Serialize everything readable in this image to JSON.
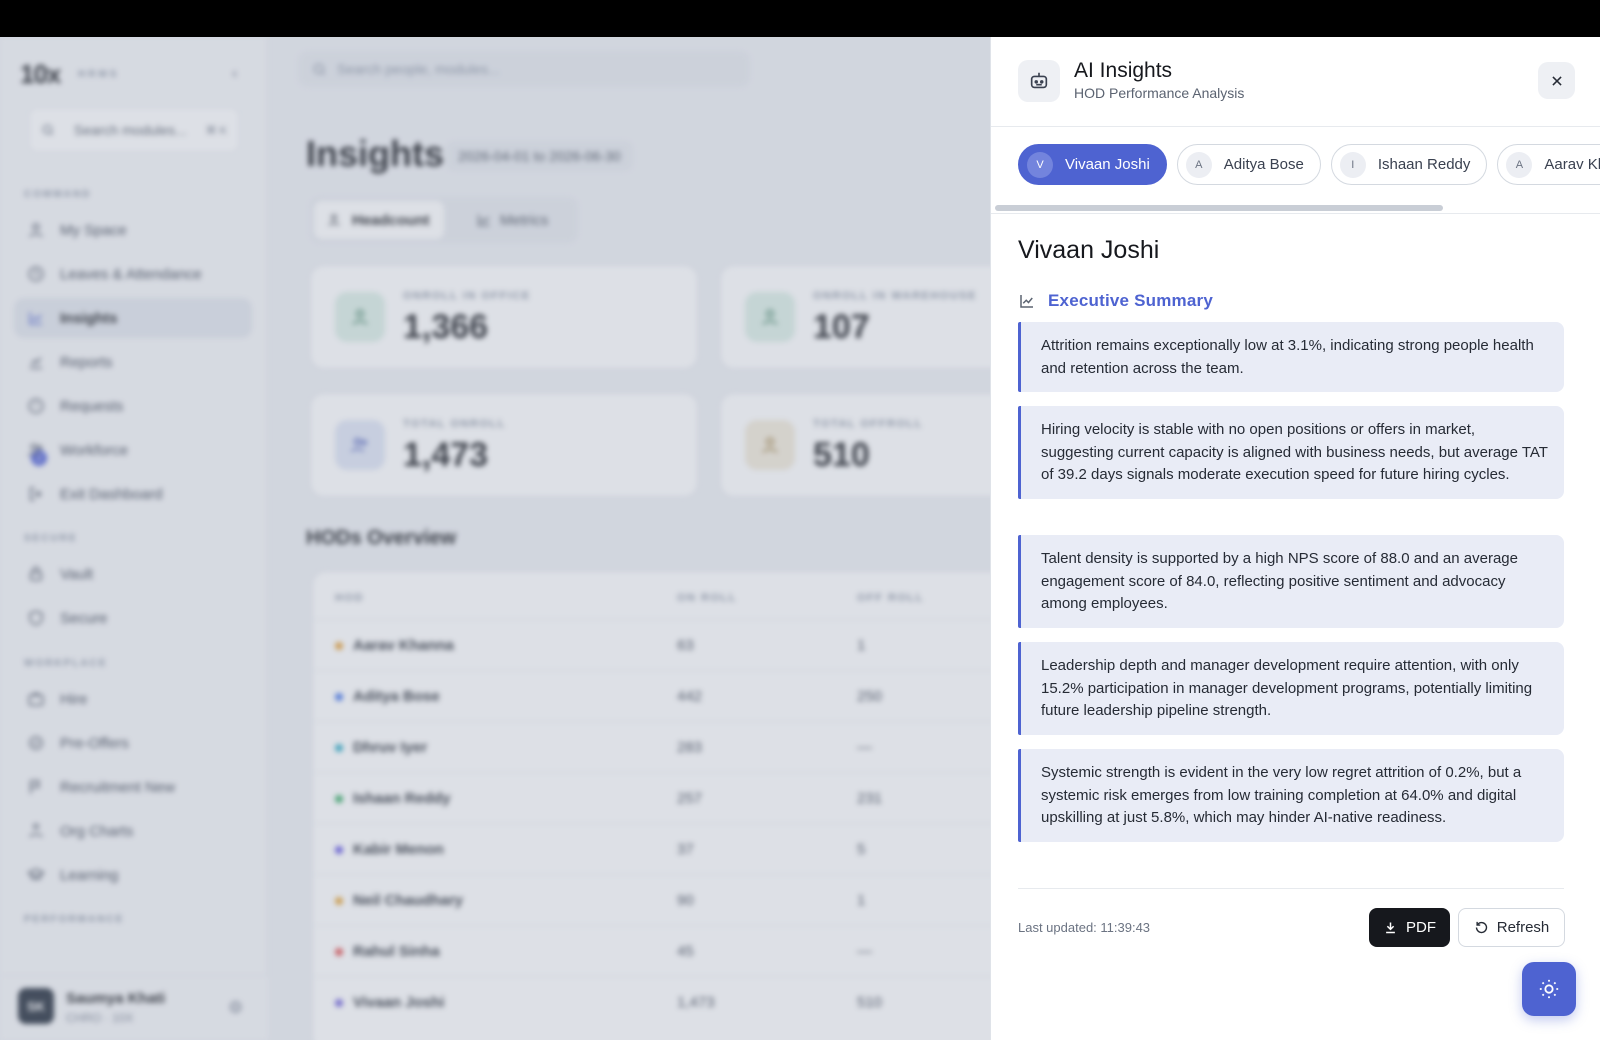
{
  "sidebar": {
    "logo": "10x",
    "logo_sub": "HRMS",
    "search_title": "Search modules...",
    "search_kbd": "⌘ K",
    "sections": {
      "command": "COMMAND",
      "secure": "SECURE",
      "workplace": "WORKPLACE",
      "performance": "PERFORMANCE"
    },
    "items": [
      {
        "label": "My Space",
        "icon": "user-icon"
      },
      {
        "label": "Leaves & Attendance",
        "icon": "clock-icon"
      },
      {
        "label": "Insights",
        "icon": "chart-icon"
      },
      {
        "label": "Reports",
        "icon": "reports-icon"
      },
      {
        "label": "Requests",
        "icon": "requests-icon"
      },
      {
        "label": "Workforce",
        "icon": "users-icon"
      },
      {
        "label": "Exit Dashboard",
        "icon": "exit-icon"
      },
      {
        "label": "Vault",
        "icon": "lock-icon"
      },
      {
        "label": "Secure",
        "icon": "shield-icon"
      },
      {
        "label": "Hire",
        "icon": "briefcase-icon"
      },
      {
        "label": "Pre-Offers",
        "icon": "badge-icon"
      },
      {
        "label": "Recruitment New",
        "icon": "flag-icon"
      },
      {
        "label": "Org Charts",
        "icon": "org-icon"
      },
      {
        "label": "Learning",
        "icon": "graduation-icon"
      }
    ],
    "requests_badge": "2",
    "user": {
      "initials": "SK",
      "name": "Saumya Khati",
      "role": "CHRO · 10X"
    }
  },
  "main": {
    "search_placeholder": "Search people, modules...",
    "title": "Insights",
    "date_range": "2026-04-01 to 2026-06-30",
    "tabs": [
      {
        "label": "Headcount"
      },
      {
        "label": "Metrics"
      }
    ],
    "cards": [
      {
        "label": "ONROLL IN OFFICE",
        "value": "1,366"
      },
      {
        "label": "ONROLL IN WAREHOUSE",
        "value": "107"
      },
      {
        "label": "TOTAL ONROLL",
        "value": "1,473"
      },
      {
        "label": "TOTAL OFFROLL",
        "value": "510"
      }
    ],
    "hods_title": "HODs Overview",
    "table_headers": [
      "HOD",
      "ON ROLL",
      "OFF ROLL"
    ],
    "rows": [
      {
        "name": "Aarav Khanna",
        "on": "63",
        "off": "1",
        "color": "#e59b2b"
      },
      {
        "name": "Aditya Bose",
        "on": "442",
        "off": "250",
        "color": "#3b6ee8"
      },
      {
        "name": "Dhruv Iyer",
        "on": "283",
        "off": "—",
        "color": "#22a6c2"
      },
      {
        "name": "Ishaan Reddy",
        "on": "257",
        "off": "231",
        "color": "#2aa65a"
      },
      {
        "name": "Kabir Menon",
        "on": "37",
        "off": "5",
        "color": "#5a4ce0"
      },
      {
        "name": "Neil Chaudhary",
        "on": "90",
        "off": "1",
        "color": "#e5a02b"
      },
      {
        "name": "Rahul Sinha",
        "on": "45",
        "off": "—",
        "color": "#e04848"
      },
      {
        "name": "Vivaan Joshi",
        "on": "1,473",
        "off": "510",
        "color": "#6a5ad8"
      }
    ]
  },
  "panel": {
    "title": "AI Insights",
    "subtitle": "HOD Performance Analysis",
    "chips": [
      {
        "initial": "V",
        "name": "Vivaan Joshi"
      },
      {
        "initial": "A",
        "name": "Aditya Bose"
      },
      {
        "initial": "I",
        "name": "Ishaan Reddy"
      },
      {
        "initial": "A",
        "name": "Aarav Khanna"
      }
    ],
    "selected_name": "Vivaan Joshi",
    "section_title": "Executive Summary",
    "insights": [
      "Attrition remains exceptionally low at 3.1%, indicating strong people health and retention across the team.",
      "Hiring velocity is stable with no open positions or offers in market, suggesting current capacity is aligned with business needs, but average TAT of 39.2 days signals moderate execution speed for future hiring cycles.",
      "Talent density is supported by a high NPS score of 88.0 and an average engagement score of 84.0, reflecting positive sentiment and advocacy among employees.",
      "Leadership depth and manager development require attention, with only 15.2% participation in manager development programs, potentially limiting future leadership pipeline strength.",
      "Systemic strength is evident in the very low regret attrition of 0.2%, but a systemic risk emerges from low training completion at 64.0% and digital upskilling at just 5.8%, which may hinder AI-native readiness."
    ],
    "last_updated": "Last updated: 11:39:43",
    "pdf_label": "PDF",
    "refresh_label": "Refresh"
  },
  "colors": {
    "accent": "#4e63d1",
    "dark": "#16181d"
  }
}
